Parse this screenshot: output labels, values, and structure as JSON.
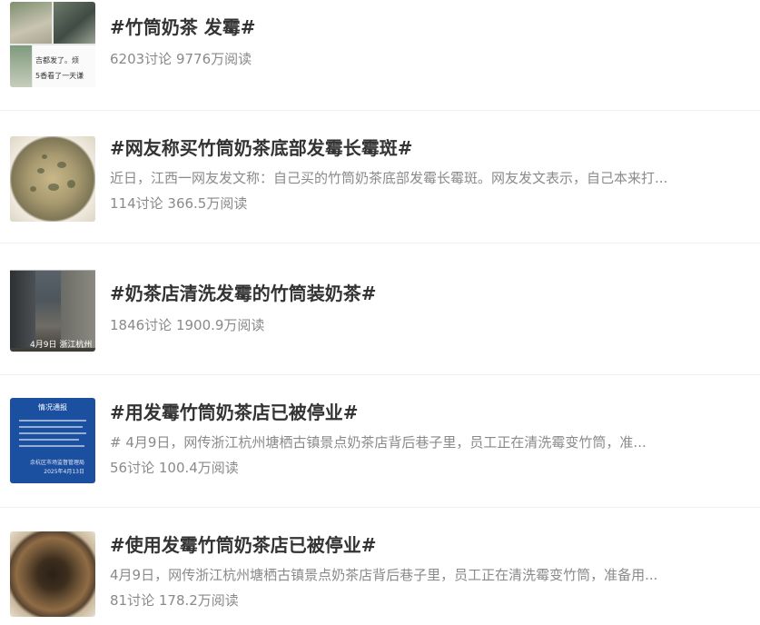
{
  "items": [
    {
      "title": "#竹筒奶茶 发霉#",
      "desc": "",
      "stats": "6203讨论 9776万阅读",
      "thumb_text": [
        "吉都发了。烦",
        "5香看了一天谦"
      ],
      "thumb_icon": "collage-thumbnail"
    },
    {
      "title": "#网友称买竹筒奶茶底部发霉长霉斑#",
      "desc": "近日，江西一网友发文称：自己买的竹筒奶茶底部发霉长霉斑。网友发文表示，自己本来打...",
      "stats": "114讨论 366.5万阅读",
      "thumb_icon": "moldy-cup-thumbnail"
    },
    {
      "title": "#奶茶店清洗发霉的竹筒装奶茶#",
      "desc": "",
      "stats": "1846讨论 1900.9万阅读",
      "thumb_text": [
        "4月9日 浙江杭州"
      ],
      "thumb_icon": "alley-thumbnail"
    },
    {
      "title": "#用发霉竹筒奶茶店已被停业#",
      "desc": "# 4月9日，网传浙江杭州塘栖古镇景点奶茶店背后巷子里，员工正在清洗霉变竹筒，准...",
      "stats": "56讨论 100.4万阅读",
      "thumb_text": [
        "情况通报",
        "余杭区市场监督管理局",
        "2025年4月13日"
      ],
      "thumb_icon": "notice-thumbnail"
    },
    {
      "title": "#使用发霉竹筒奶茶店已被停业#",
      "desc": "4月9日，网传浙江杭州塘栖古镇景点奶茶店背后巷子里，员工正在清洗霉变竹筒，准备用...",
      "stats": "81讨论 178.2万阅读",
      "thumb_icon": "moldy-bamboo-thumbnail"
    }
  ]
}
